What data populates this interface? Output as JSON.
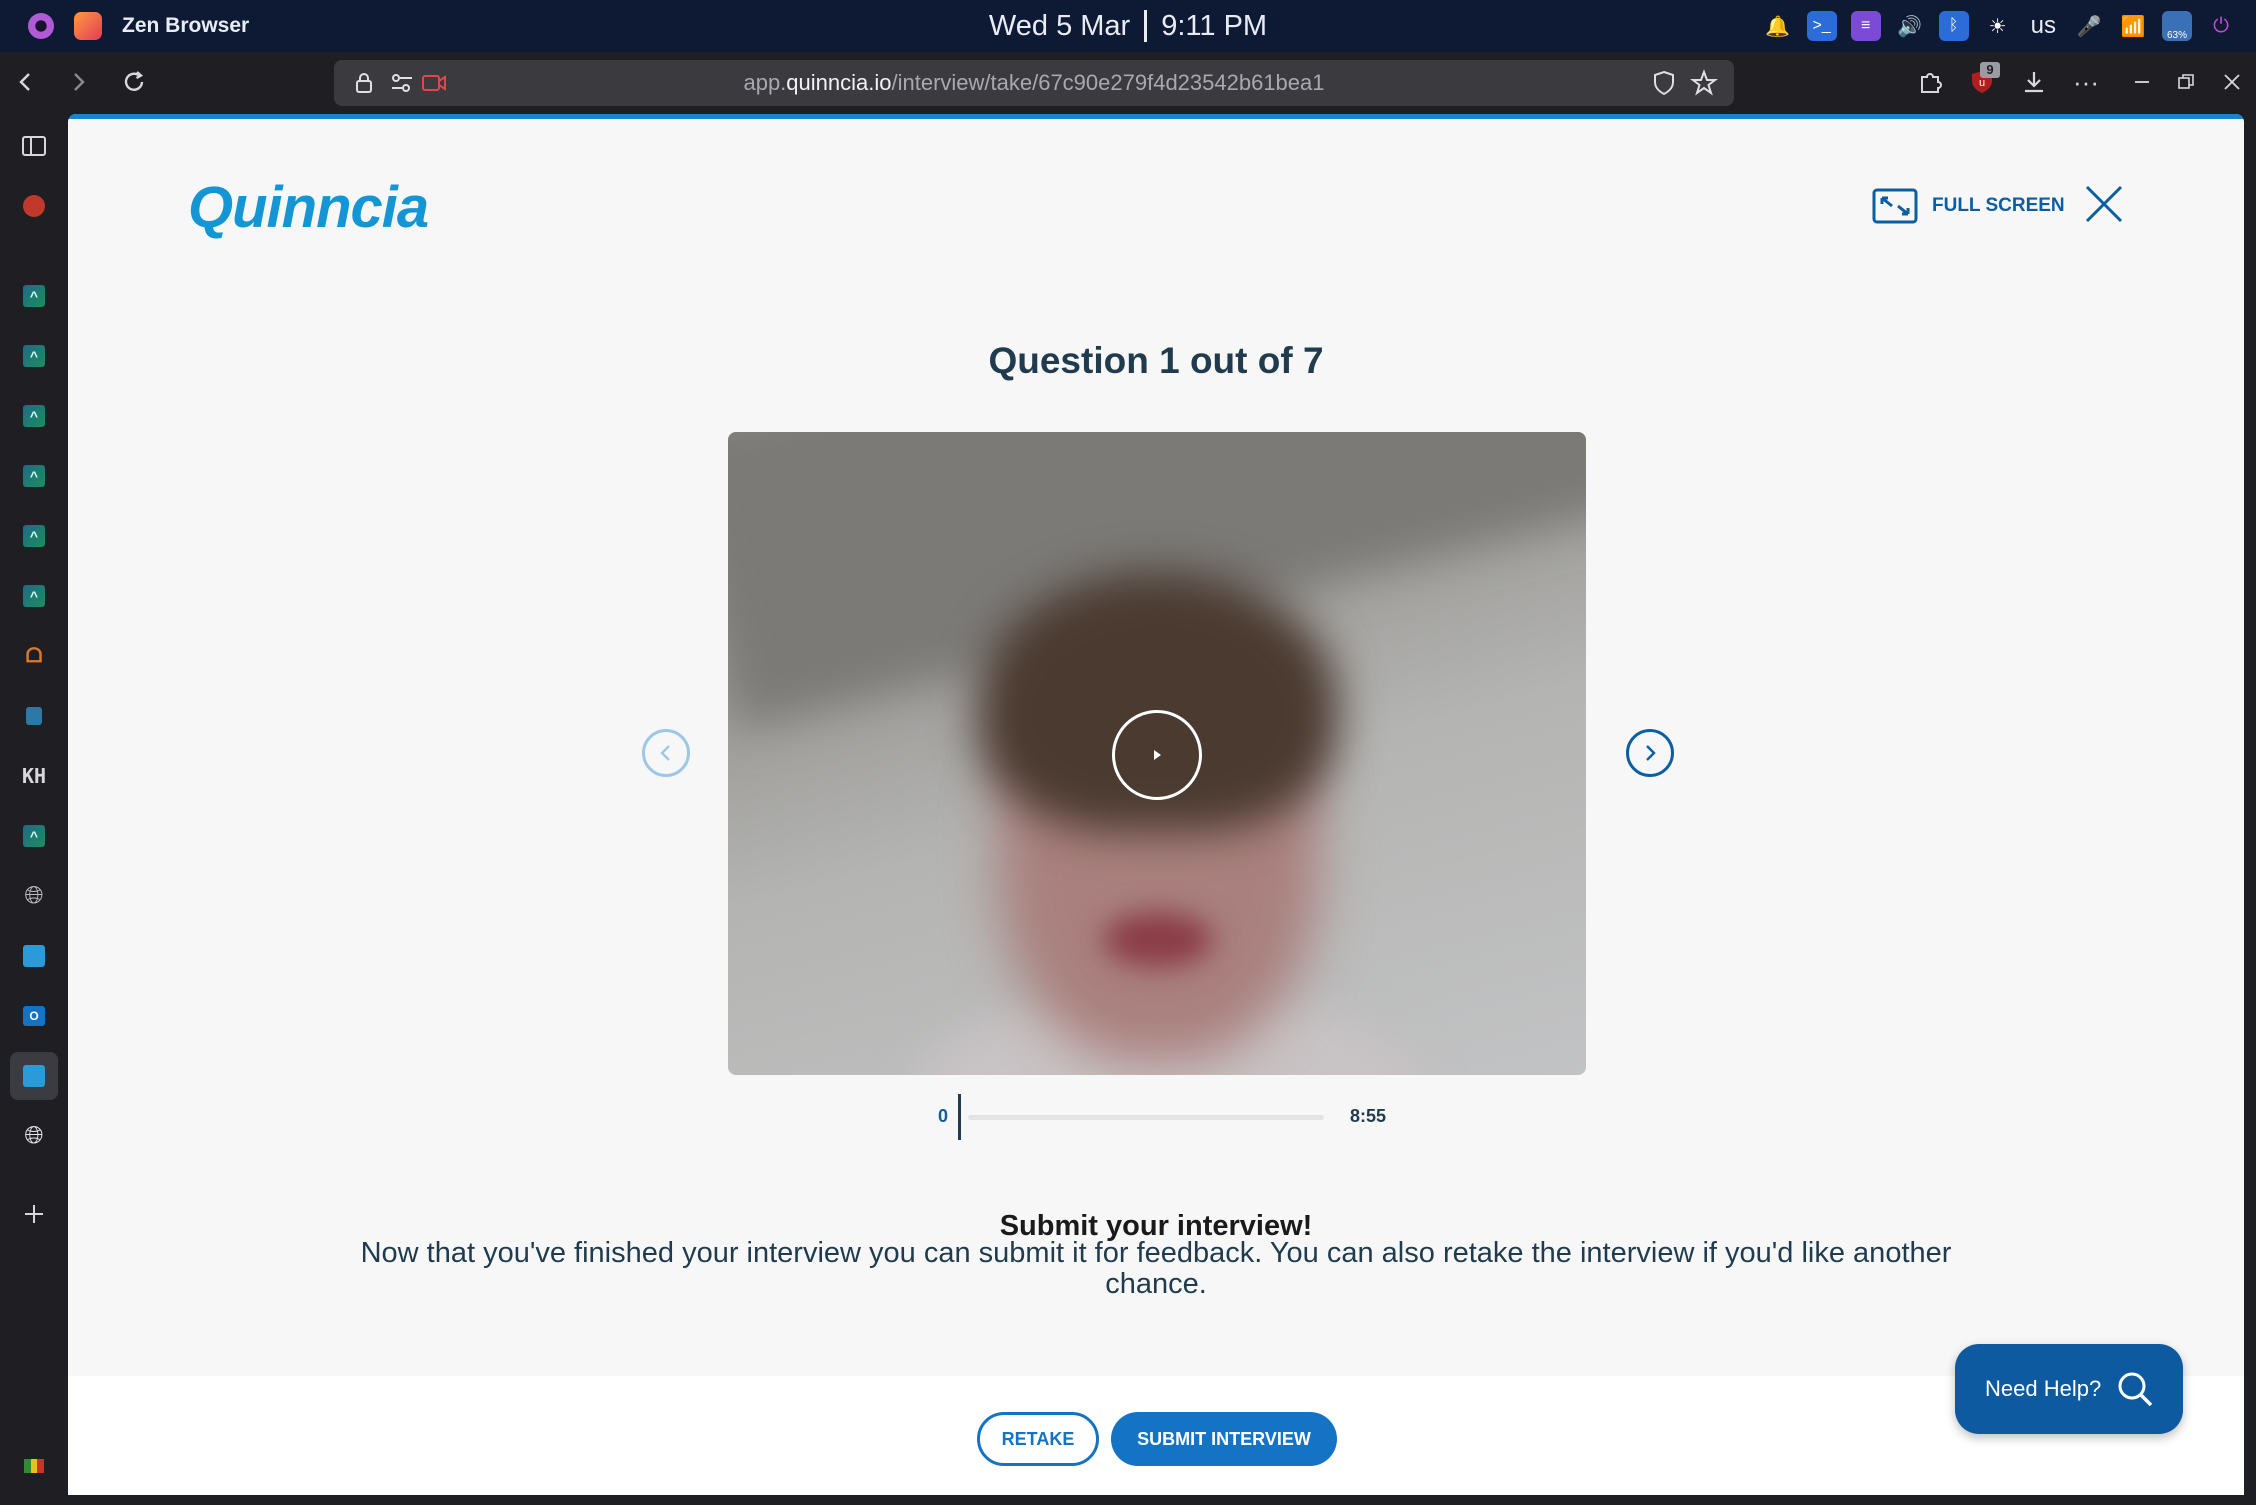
{
  "system": {
    "app_name": "Zen Browser",
    "date": "Wed 5 Mar",
    "time": "9:11 PM",
    "keyboard_layout": "us",
    "battery_percent": "63%"
  },
  "browser": {
    "url_prefix": "app.",
    "url_host": "quinncia.io",
    "url_path": "/interview/take/67c90e279f4d23542b61bea1",
    "extensions_badge": "9"
  },
  "sidebar": {
    "items": [
      "panel-toggle",
      "pinned-red",
      "app-1",
      "app-2",
      "app-3",
      "app-4",
      "app-5",
      "app-6",
      "app-orange",
      "app-7",
      "app-kh",
      "app-8",
      "globe-1",
      "app-9",
      "outlook",
      "app-active",
      "globe-2"
    ]
  },
  "page": {
    "logo": "Quinncia",
    "fullscreen_label": "FULL SCREEN",
    "question_title": "Question 1 out of 7",
    "timeline_start": "0",
    "timeline_end": "8:55",
    "submit_title": "Submit your interview!",
    "submit_text": "Now that you've finished your interview you can submit it for feedback. You can also retake the interview if you'd like another chance.",
    "retake_label": "RETAKE",
    "submit_label": "SUBMIT INTERVIEW",
    "help_label": "Need Help?"
  },
  "colors": {
    "brand_blue": "#1496d4",
    "primary_button": "#1473c4",
    "help_button": "#0d5aa0",
    "heading": "#1f3b4d"
  }
}
